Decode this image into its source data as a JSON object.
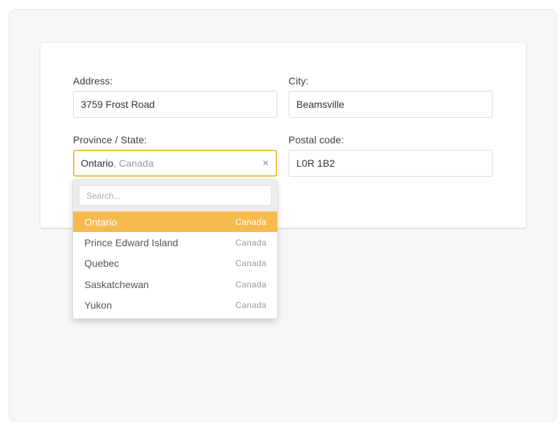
{
  "colors": {
    "accent": "#f6bb4f",
    "background": "#f8f7f5",
    "card": "#ffffff"
  },
  "form": {
    "address": {
      "label": "Address:",
      "value": "3759 Frost Road"
    },
    "city": {
      "label": "City:",
      "value": "Beamsville"
    },
    "province": {
      "label": "Province / State:",
      "value": "Ontario",
      "country_suffix": ", Canada",
      "clear_icon": "×"
    },
    "postal": {
      "label": "Postal code:",
      "value": "L0R 1B2"
    }
  },
  "dropdown": {
    "search_placeholder": "Search...",
    "items": [
      {
        "name": "Ontario",
        "country": "Canada",
        "active": true
      },
      {
        "name": "Prince Edward Island",
        "country": "Canada",
        "active": false
      },
      {
        "name": "Quebec",
        "country": "Canada",
        "active": false
      },
      {
        "name": "Saskatchewan",
        "country": "Canada",
        "active": false
      },
      {
        "name": "Yukon",
        "country": "Canada",
        "active": false
      }
    ]
  }
}
